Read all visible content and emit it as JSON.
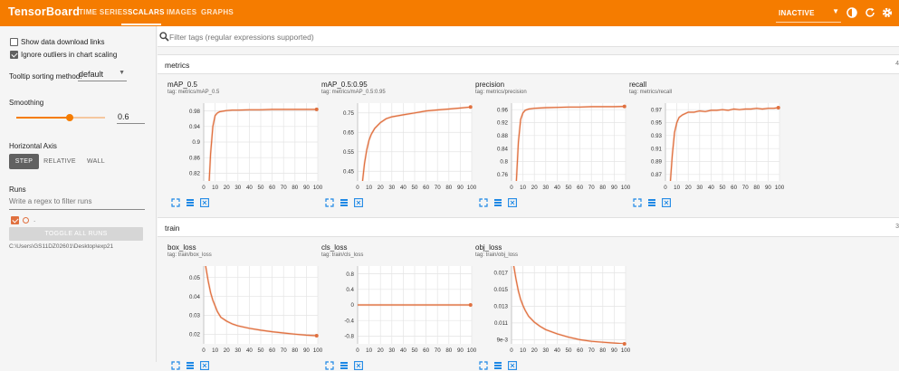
{
  "app": {
    "brand": "TensorBoard",
    "tabs": [
      "TIME SERIES",
      "SCALARS",
      "IMAGES",
      "GRAPHS"
    ],
    "active_tab": "SCALARS",
    "status_select": "INACTIVE",
    "colors": {
      "header": "#f57c00",
      "series": "#e0703f"
    },
    "icons": [
      "chevron-down-icon",
      "contrast-icon",
      "refresh-icon",
      "settings-icon"
    ]
  },
  "sidebar": {
    "show_download_label": "Show data download links",
    "show_download_checked": false,
    "ignore_outliers_label": "Ignore outliers in chart scaling",
    "ignore_outliers_checked": true,
    "tooltip_label": "Tooltip sorting method:",
    "tooltip_value": "default",
    "smoothing_label": "Smoothing",
    "smoothing_value": "0.6",
    "smoothing_fraction": 0.6,
    "horizontal_axis_label": "Horizontal Axis",
    "axis_options": [
      "STEP",
      "RELATIVE",
      "WALL"
    ],
    "axis_selected": "STEP",
    "runs_label": "Runs",
    "runs_filter_placeholder": "Write a regex to filter runs",
    "run_name": ".",
    "toggle_all_label": "TOGGLE ALL RUNS",
    "run_path": "C:\\Users\\GS11DZ02601\\Desktop\\exp21"
  },
  "filter": {
    "placeholder": "Filter tags (regular expressions supported)"
  },
  "groups": [
    {
      "name": "metrics",
      "count": "4"
    },
    {
      "name": "train",
      "count": "3"
    }
  ],
  "chart_data": [
    {
      "type": "line",
      "title": "mAP_0.5",
      "tag": "tag: metrics/mAP_0.5",
      "xticks": [
        0,
        10,
        20,
        30,
        40,
        50,
        60,
        70,
        80,
        90,
        100
      ],
      "yticks": [
        "0.98",
        "0.94",
        "0.9",
        "0.86",
        "0.82"
      ],
      "ylim": [
        0.8,
        1.0
      ],
      "xlim": [
        0,
        100
      ],
      "x": [
        0,
        2,
        4,
        6,
        8,
        10,
        12,
        14,
        16,
        18,
        20,
        25,
        30,
        40,
        50,
        60,
        70,
        80,
        90,
        99
      ],
      "y": [
        0.55,
        0.62,
        0.75,
        0.87,
        0.94,
        0.968,
        0.975,
        0.978,
        0.979,
        0.98,
        0.981,
        0.982,
        0.982,
        0.983,
        0.983,
        0.984,
        0.984,
        0.984,
        0.984,
        0.984
      ]
    },
    {
      "type": "line",
      "title": "mAP_0.5:0.95",
      "tag": "tag: metrics/mAP_0.5:0.95",
      "xticks": [
        0,
        10,
        20,
        30,
        40,
        50,
        60,
        70,
        80,
        90,
        100
      ],
      "yticks": [
        "0.75",
        "0.65",
        "0.55",
        "0.45"
      ],
      "ylim": [
        0.4,
        0.8
      ],
      "xlim": [
        0,
        100
      ],
      "x": [
        0,
        2,
        4,
        6,
        8,
        10,
        12,
        15,
        20,
        25,
        30,
        40,
        50,
        60,
        70,
        80,
        90,
        99
      ],
      "y": [
        0.2,
        0.28,
        0.38,
        0.49,
        0.56,
        0.61,
        0.64,
        0.67,
        0.7,
        0.72,
        0.73,
        0.74,
        0.75,
        0.76,
        0.765,
        0.77,
        0.775,
        0.78
      ]
    },
    {
      "type": "line",
      "title": "precision",
      "tag": "tag: metrics/precision",
      "xticks": [
        0,
        10,
        20,
        30,
        40,
        50,
        60,
        70,
        80,
        90,
        100
      ],
      "yticks": [
        "0.96",
        "0.92",
        "0.88",
        "0.84",
        "0.8",
        "0.76"
      ],
      "ylim": [
        0.74,
        0.98
      ],
      "xlim": [
        0,
        100
      ],
      "x": [
        0,
        2,
        4,
        6,
        8,
        10,
        12,
        15,
        20,
        30,
        40,
        50,
        60,
        70,
        80,
        90,
        99
      ],
      "y": [
        0.5,
        0.6,
        0.72,
        0.86,
        0.93,
        0.95,
        0.958,
        0.962,
        0.964,
        0.966,
        0.967,
        0.968,
        0.968,
        0.969,
        0.969,
        0.969,
        0.97
      ]
    },
    {
      "type": "line",
      "title": "recall",
      "tag": "tag: metrics/recall",
      "xticks": [
        0,
        10,
        20,
        30,
        40,
        50,
        60,
        70,
        80,
        90,
        100
      ],
      "yticks": [
        "0.97",
        "0.95",
        "0.93",
        "0.91",
        "0.89",
        "0.87"
      ],
      "ylim": [
        0.86,
        0.98
      ],
      "xlim": [
        0,
        100
      ],
      "x": [
        0,
        2,
        4,
        6,
        8,
        10,
        12,
        15,
        20,
        25,
        30,
        35,
        40,
        45,
        50,
        55,
        60,
        65,
        70,
        75,
        80,
        85,
        90,
        95,
        99
      ],
      "y": [
        0.7,
        0.78,
        0.85,
        0.9,
        0.935,
        0.95,
        0.958,
        0.962,
        0.966,
        0.966,
        0.968,
        0.967,
        0.969,
        0.969,
        0.97,
        0.969,
        0.971,
        0.97,
        0.971,
        0.971,
        0.972,
        0.971,
        0.972,
        0.972,
        0.973
      ]
    },
    {
      "type": "line",
      "title": "box_loss",
      "tag": "tag: train/box_loss",
      "xticks": [
        0,
        10,
        20,
        30,
        40,
        50,
        60,
        70,
        80,
        90,
        100
      ],
      "yticks": [
        "0.05",
        "0.04",
        "0.03",
        "0.02"
      ],
      "ylim": [
        0.015,
        0.056
      ],
      "xlim": [
        0,
        100
      ],
      "x": [
        0,
        2,
        4,
        6,
        8,
        10,
        12,
        15,
        20,
        25,
        30,
        40,
        50,
        60,
        70,
        80,
        90,
        99
      ],
      "y": [
        0.062,
        0.055,
        0.048,
        0.042,
        0.038,
        0.035,
        0.032,
        0.029,
        0.027,
        0.0255,
        0.0245,
        0.0232,
        0.0222,
        0.0214,
        0.0207,
        0.0201,
        0.0196,
        0.0193
      ]
    },
    {
      "type": "line",
      "title": "cls_loss",
      "tag": "tag: train/cls_loss",
      "xticks": [
        0,
        10,
        20,
        30,
        40,
        50,
        60,
        70,
        80,
        90,
        100
      ],
      "yticks": [
        "0.8",
        "0.4",
        "0",
        "-0.4",
        "-0.8"
      ],
      "ylim": [
        -1.0,
        1.0
      ],
      "xlim": [
        0,
        100
      ],
      "x": [
        0,
        10,
        20,
        30,
        40,
        50,
        60,
        70,
        80,
        90,
        99
      ],
      "y": [
        0,
        0,
        0,
        0,
        0,
        0,
        0,
        0,
        0,
        0,
        0
      ]
    },
    {
      "type": "line",
      "title": "obj_loss",
      "tag": "tag: train/obj_loss",
      "xticks": [
        0,
        10,
        20,
        30,
        40,
        50,
        60,
        70,
        80,
        90,
        100
      ],
      "yticks": [
        "0.017",
        "0.015",
        "0.013",
        "0.011",
        "9e-3"
      ],
      "ylim": [
        0.0085,
        0.0178
      ],
      "xlim": [
        0,
        100
      ],
      "x": [
        0,
        2,
        4,
        6,
        8,
        10,
        12,
        15,
        20,
        25,
        30,
        40,
        50,
        60,
        70,
        80,
        90,
        99
      ],
      "y": [
        0.0195,
        0.0178,
        0.0162,
        0.0148,
        0.0138,
        0.0131,
        0.0125,
        0.0118,
        0.0111,
        0.0106,
        0.0102,
        0.0097,
        0.0093,
        0.009,
        0.0088,
        0.0087,
        0.0086,
        0.0085
      ]
    }
  ]
}
